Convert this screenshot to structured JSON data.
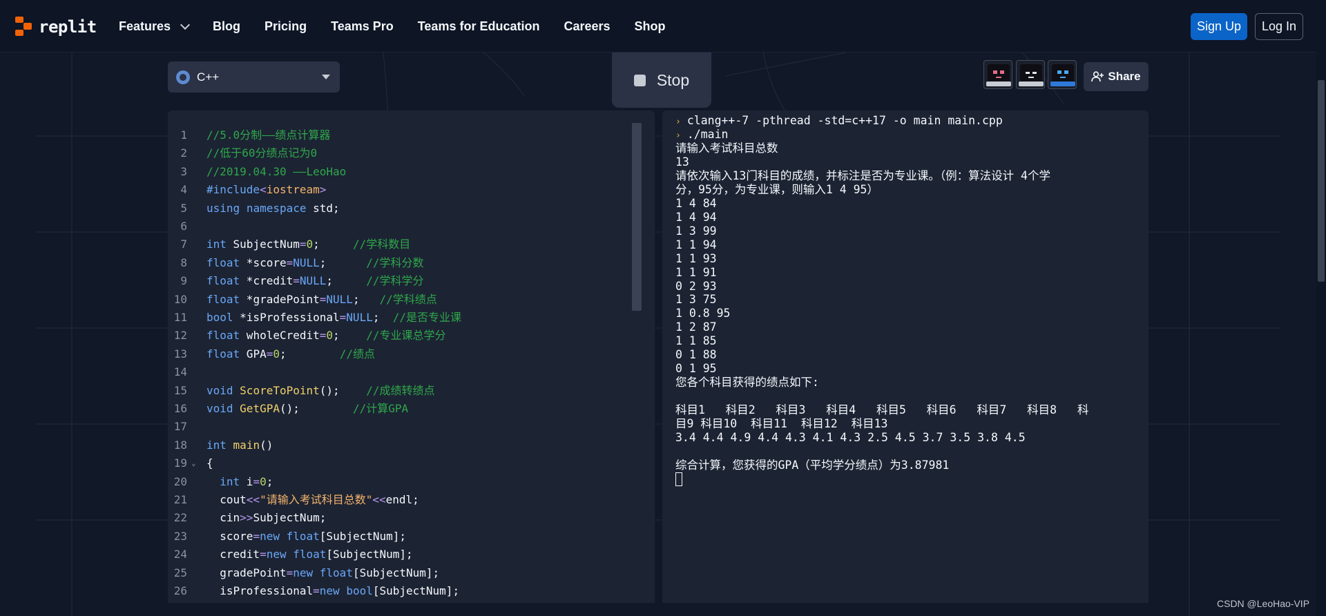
{
  "nav": {
    "logo": "replit",
    "links": [
      "Features",
      "Blog",
      "Pricing",
      "Teams Pro",
      "Teams for Education",
      "Careers",
      "Shop"
    ],
    "signup": "Sign Up",
    "login": "Log In"
  },
  "toolbar": {
    "language": "C++",
    "stop": "Stop",
    "share": "Share"
  },
  "editor": {
    "lines": [
      "//5.0分制——绩点计算器",
      "//低于60分绩点记为0",
      "//2019.04.30 ——LeoHao",
      "#include<iostream>",
      "using namespace std;",
      "",
      "int SubjectNum=0;     //学科数目",
      "float *score=NULL;      //学科分数",
      "float *credit=NULL;     //学科学分",
      "float *gradePoint=NULL;   //学科绩点",
      "bool *isProfessional=NULL;  //是否专业课",
      "float wholeCredit=0;    //专业课总学分",
      "float GPA=0;        //绩点",
      "",
      "void ScoreToPoint();    //成绩转绩点",
      "void GetGPA();        //计算GPA",
      "",
      "int main()",
      "{",
      "  int i=0;",
      "  cout<<\"请输入考试科目总数\"<<endl;",
      "  cin>>SubjectNum;",
      "  score=new float[SubjectNum];",
      "  credit=new float[SubjectNum];",
      "  gradePoint=new float[SubjectNum];",
      "  isProfessional=new bool[SubjectNum];"
    ]
  },
  "console": {
    "commands": [
      "clang++-7 -pthread -std=c++17 -o main main.cpp",
      "./main"
    ],
    "output": [
      "请输入考试科目总数",
      "13",
      "请依次输入13门科目的成绩，并标注是否为专业课。（例：算法设计 4个学",
      "分，95分，为专业课，则输入1 4 95）",
      "1 4 84",
      "1 4 94",
      "1 3 99",
      "1 1 94",
      "1 1 93",
      "1 1 91",
      "0 2 93",
      "1 3 75",
      "1 0.8 95",
      "1 2 87",
      "1 1 85",
      "0 1 88",
      "0 1 95",
      "您各个科目获得的绩点如下:",
      "",
      "科目1   科目2   科目3   科目4   科目5   科目6   科目7   科目8   科",
      "目9 科目10  科目11  科目12  科目13",
      "3.4 4.4 4.9 4.4 4.3 4.1 4.3 2.5 4.5 3.7 3.5 3.8 4.5",
      "",
      "综合计算，您获得的GPA（平均学分绩点）为3.87981"
    ]
  },
  "watermark": "CSDN @LeoHao-VIP",
  "colors": {
    "brand": "#f26207",
    "signup": "#0b64c8",
    "panel": "#1c2333",
    "comment": "#2fa84a",
    "keyword": "#6aa8f7"
  }
}
